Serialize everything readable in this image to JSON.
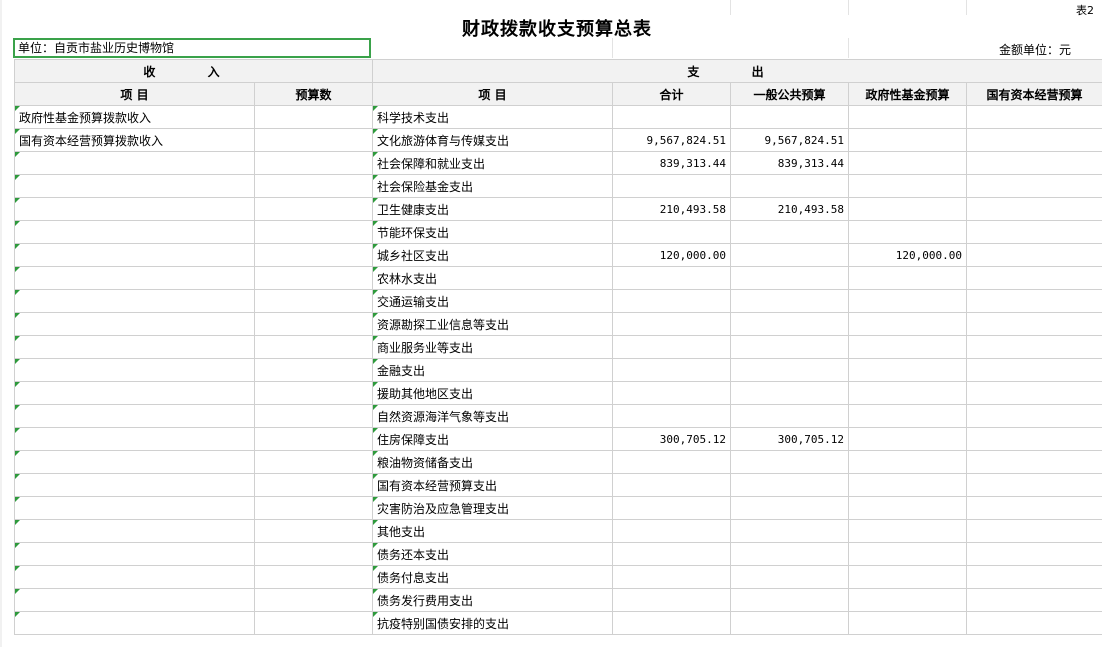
{
  "sheet": {
    "table_tag": "表2",
    "title": "财政拨款收支预算总表",
    "unit_label": "单位：自贡市盐业历史博物馆",
    "amount_unit": "金额单位：元"
  },
  "header": {
    "income": "收  入",
    "expense": "支  出",
    "income_item": "项  目",
    "income_budget": "预算数",
    "expense_item": "项  目",
    "total": "合计",
    "general_public": "一般公共预算",
    "gov_fund": "政府性基金预算",
    "state_capital": "国有资本经营预算"
  },
  "rows": [
    {
      "income_item": "政府性基金预算拨款收入",
      "income_budget": "",
      "expense_item": "科学技术支出",
      "total": "",
      "general": "",
      "fund": "",
      "capital": ""
    },
    {
      "income_item": "国有资本经营预算拨款收入",
      "income_budget": "",
      "expense_item": "文化旅游体育与传媒支出",
      "total": "9,567,824.51",
      "general": "9,567,824.51",
      "fund": "",
      "capital": ""
    },
    {
      "income_item": "",
      "income_budget": "",
      "expense_item": "社会保障和就业支出",
      "total": "839,313.44",
      "general": "839,313.44",
      "fund": "",
      "capital": ""
    },
    {
      "income_item": "",
      "income_budget": "",
      "expense_item": "社会保险基金支出",
      "total": "",
      "general": "",
      "fund": "",
      "capital": ""
    },
    {
      "income_item": "",
      "income_budget": "",
      "expense_item": "卫生健康支出",
      "total": "210,493.58",
      "general": "210,493.58",
      "fund": "",
      "capital": ""
    },
    {
      "income_item": "",
      "income_budget": "",
      "expense_item": "节能环保支出",
      "total": "",
      "general": "",
      "fund": "",
      "capital": ""
    },
    {
      "income_item": "",
      "income_budget": "",
      "expense_item": "城乡社区支出",
      "total": "120,000.00",
      "general": "",
      "fund": "120,000.00",
      "capital": ""
    },
    {
      "income_item": "",
      "income_budget": "",
      "expense_item": "农林水支出",
      "total": "",
      "general": "",
      "fund": "",
      "capital": ""
    },
    {
      "income_item": "",
      "income_budget": "",
      "expense_item": "交通运输支出",
      "total": "",
      "general": "",
      "fund": "",
      "capital": ""
    },
    {
      "income_item": "",
      "income_budget": "",
      "expense_item": "资源勘探工业信息等支出",
      "total": "",
      "general": "",
      "fund": "",
      "capital": ""
    },
    {
      "income_item": "",
      "income_budget": "",
      "expense_item": "商业服务业等支出",
      "total": "",
      "general": "",
      "fund": "",
      "capital": ""
    },
    {
      "income_item": "",
      "income_budget": "",
      "expense_item": "金融支出",
      "total": "",
      "general": "",
      "fund": "",
      "capital": ""
    },
    {
      "income_item": "",
      "income_budget": "",
      "expense_item": "援助其他地区支出",
      "total": "",
      "general": "",
      "fund": "",
      "capital": ""
    },
    {
      "income_item": "",
      "income_budget": "",
      "expense_item": "自然资源海洋气象等支出",
      "total": "",
      "general": "",
      "fund": "",
      "capital": ""
    },
    {
      "income_item": "",
      "income_budget": "",
      "expense_item": "住房保障支出",
      "total": "300,705.12",
      "general": "300,705.12",
      "fund": "",
      "capital": ""
    },
    {
      "income_item": "",
      "income_budget": "",
      "expense_item": "粮油物资储备支出",
      "total": "",
      "general": "",
      "fund": "",
      "capital": ""
    },
    {
      "income_item": "",
      "income_budget": "",
      "expense_item": "国有资本经营预算支出",
      "total": "",
      "general": "",
      "fund": "",
      "capital": ""
    },
    {
      "income_item": "",
      "income_budget": "",
      "expense_item": "灾害防治及应急管理支出",
      "total": "",
      "general": "",
      "fund": "",
      "capital": ""
    },
    {
      "income_item": "",
      "income_budget": "",
      "expense_item": "其他支出",
      "total": "",
      "general": "",
      "fund": "",
      "capital": ""
    },
    {
      "income_item": "",
      "income_budget": "",
      "expense_item": "债务还本支出",
      "total": "",
      "general": "",
      "fund": "",
      "capital": ""
    },
    {
      "income_item": "",
      "income_budget": "",
      "expense_item": "债务付息支出",
      "total": "",
      "general": "",
      "fund": "",
      "capital": ""
    },
    {
      "income_item": "",
      "income_budget": "",
      "expense_item": "债务发行费用支出",
      "total": "",
      "general": "",
      "fund": "",
      "capital": ""
    },
    {
      "income_item": "",
      "income_budget": "",
      "expense_item": "抗疫特别国债安排的支出",
      "total": "",
      "general": "",
      "fund": "",
      "capital": ""
    }
  ]
}
